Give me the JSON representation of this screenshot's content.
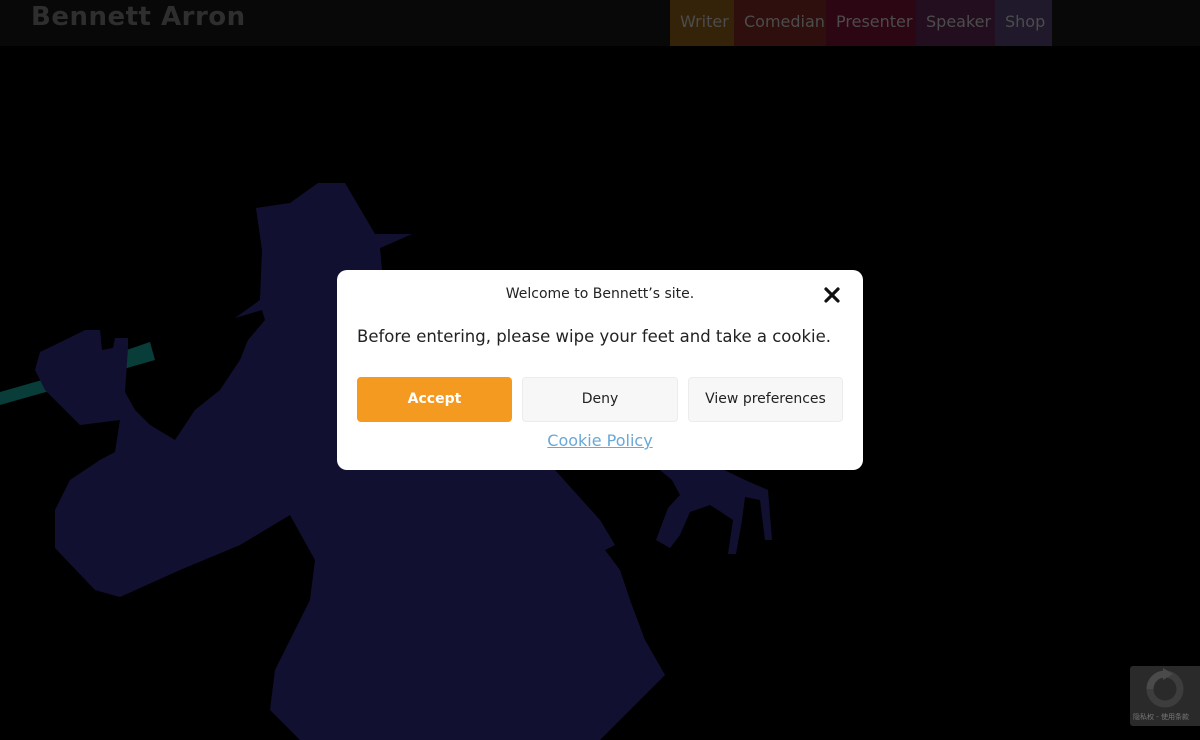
{
  "header": {
    "site_title": "Bennett Arron",
    "nav": [
      {
        "label": "Writer",
        "color": "#5f3f11"
      },
      {
        "label": "Comedian",
        "color": "#541d1b"
      },
      {
        "label": "Presenter",
        "color": "#530c24"
      },
      {
        "label": "Speaker",
        "color": "#401a3a"
      },
      {
        "label": "Shop",
        "color": "#3a2f4f"
      }
    ]
  },
  "hero": {
    "silhouette_color": "#221e5a",
    "microphone_color": "#0f6f6a",
    "icon": "comedian-silhouette-illustration"
  },
  "cookie_banner": {
    "title": "Welcome to Bennett’s site.",
    "message": "Before entering, please wipe your feet and take a cookie.",
    "accept_label": "Accept",
    "deny_label": "Deny",
    "preferences_label": "View preferences",
    "policy_link": "Cookie Policy",
    "accent_color": "#f49a20",
    "close_icon": "close-icon"
  },
  "recaptcha": {
    "icon": "recaptcha-icon",
    "terms": "隐私权 - 使用条款"
  }
}
